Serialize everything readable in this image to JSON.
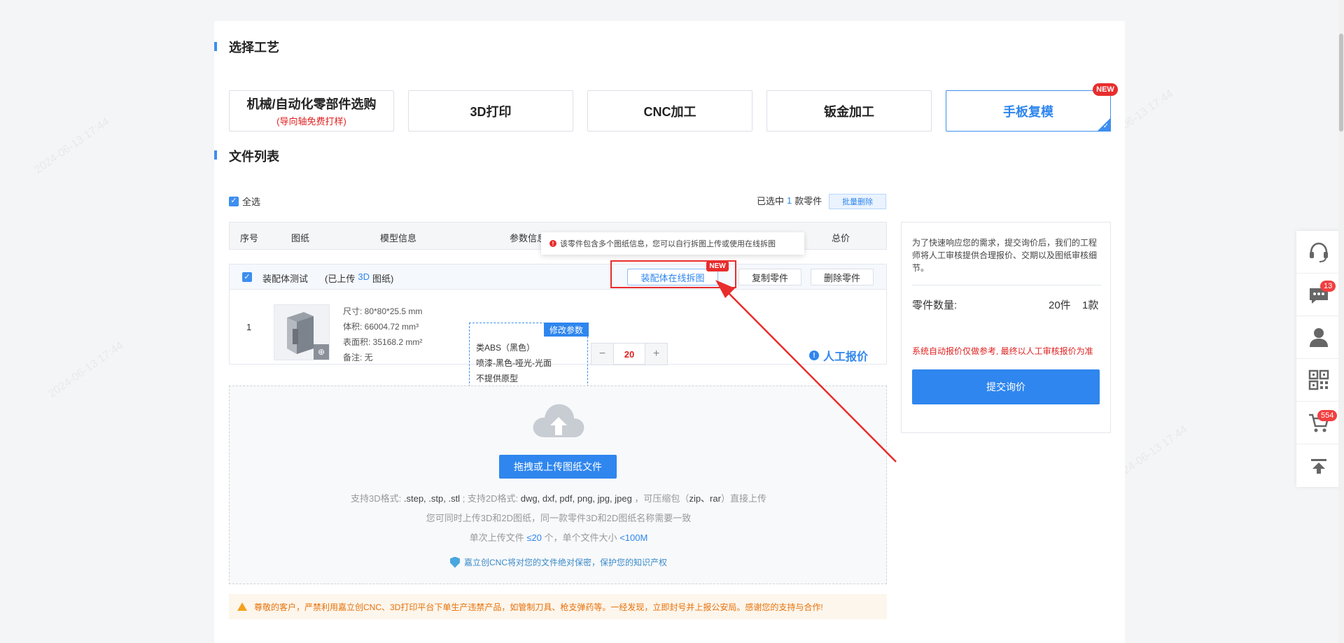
{
  "sections": {
    "process_title": "选择工艺",
    "files_title": "文件列表"
  },
  "processes": [
    {
      "label": "机械/自动化零部件选购",
      "sub": "(导向轴免费打样)"
    },
    {
      "label": "3D打印",
      "sub": ""
    },
    {
      "label": "CNC加工",
      "sub": ""
    },
    {
      "label": "钣金加工",
      "sub": ""
    },
    {
      "label": "手板复模",
      "sub": "",
      "badge": "NEW"
    }
  ],
  "select_all": "全选",
  "selection": {
    "prefix": "已选中",
    "count": "1",
    "suffix": "款零件",
    "bulk_delete": "批量删除"
  },
  "table": {
    "headers": [
      "序号",
      "图纸",
      "模型信息",
      "参数信息",
      "总价"
    ],
    "tooltip": "该零件包含多个图纸信息，您可以自行拆图上传或使用在线拆图",
    "group": {
      "name": "装配体测试",
      "upload_note_prefix": "(已上传",
      "upload_note_type": "3D",
      "upload_note_suffix": "图纸)",
      "btn_online_split": "装配体在线拆图",
      "btn_online_split_badge": "NEW",
      "btn_copy": "复制零件",
      "btn_delete": "删除零件"
    },
    "row": {
      "index": "1",
      "size": "尺寸: 80*80*25.5 mm",
      "volume": "体积: 66004.72 mm³",
      "area": "表面积: 35168.2 mm²",
      "note": "备注: 无",
      "modify_label": "修改参数",
      "material": "类ABS（黑色）",
      "finish": "喷漆-黑色-哑光-光面",
      "prototype": "不提供原型",
      "quantity": "20",
      "price_label": "人工报价"
    }
  },
  "upload": {
    "button": "拖拽或上传图纸文件",
    "formats_3d_label": "支持3D格式:",
    "formats_3d": ".step, .stp, .stl",
    "formats_2d_label": "; 支持2D格式:",
    "formats_2d": "dwg, dxf, pdf, png, jpg, jpeg",
    "compress_prefix": "，可压缩包（",
    "compress_types": "zip、rar",
    "compress_suffix": "）直接上传",
    "line2": "您可同时上传3D和2D图纸，同一款零件3D和2D图纸名称需要一致",
    "line3_prefix": "单次上传文件",
    "line3_count": "≤20",
    "line3_mid": "个，单个文件大小",
    "line3_size": "<100M",
    "privacy": "嘉立创CNC将对您的文件绝对保密，保护您的知识产权"
  },
  "warning": "尊敬的客户，严禁利用嘉立创CNC、3D打印平台下单生产违禁产品，如管制刀具、枪支弹药等。一经发现，立即封号并上报公安局。感谢您的支持与合作!",
  "summary": {
    "intro": "为了快速响应您的需求，提交询价后，我们的工程师将人工审核提供合理报价、交期以及图纸审核细节。",
    "qty_label": "零件数量:",
    "qty_pieces": "20件",
    "qty_kinds": "1款",
    "disclaimer": "系统自动报价仅做参考, 最终以人工审核报价为准",
    "submit": "提交询价"
  },
  "sidebar": {
    "items": [
      {
        "icon": "headset-icon"
      },
      {
        "icon": "chat-icon",
        "badge": "13"
      },
      {
        "icon": "user-icon"
      },
      {
        "icon": "qrcode-icon"
      },
      {
        "icon": "cart-icon",
        "badge": "554"
      },
      {
        "icon": "back-to-top-icon"
      }
    ]
  },
  "colors": {
    "accent": "#2f86ee",
    "danger": "#e82d2d",
    "warning_bg": "#fdf6ec",
    "warning_text": "#e6720c"
  }
}
